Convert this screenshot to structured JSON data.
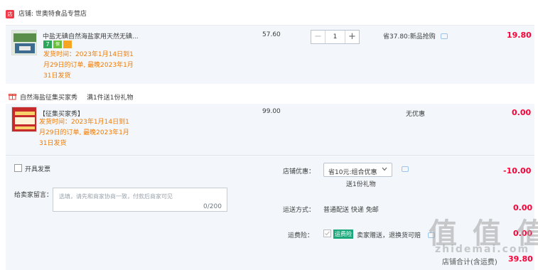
{
  "shop": {
    "label": "店铺: 世奥特食品专营店",
    "tag_icon": "shop-tag-icon"
  },
  "item1": {
    "title": "中盐无碘自然海盐家用天然无碘...",
    "badges": [
      "7",
      "保障",
      "card"
    ],
    "ship_lines": [
      "发货时间：2023年1月14日到1",
      "月29日的订单, 最晚2023年1月",
      "31日发货"
    ],
    "unit_price": "57.60",
    "quantity": "1",
    "promo": "省37.80:新品抢购",
    "subtotal": "19.80"
  },
  "gift": {
    "label": "自然海盐征集买家秀",
    "rule": "满1件送1份礼物"
  },
  "item2": {
    "title": "【征集买家秀】",
    "ship_lines": [
      "发货时间：2023年1月14日到1",
      "月29日的订单, 最晚2023年1月",
      "31日发货"
    ],
    "unit_price": "99.00",
    "promo": "无优惠",
    "subtotal": "0.00"
  },
  "invoice": {
    "label": "开具发票"
  },
  "message": {
    "label": "给卖家留言：",
    "placeholder": "选填，请先和商家协商一致，付款后商家可见",
    "counter": "0/200"
  },
  "shop_discount": {
    "label": "店铺优惠：",
    "selected": "省10元:组合优惠",
    "note": "送1份礼物",
    "amount": "-10.00"
  },
  "delivery": {
    "label": "运送方式：",
    "value": "普通配送 快递 免邮",
    "amount": "0.00"
  },
  "insurance": {
    "label": "运费险：",
    "tag": "运费险",
    "value": "卖家赠送，退换货可赔",
    "amount": "0.00"
  },
  "total": {
    "label": "店铺合计(含运费)",
    "amount": "39.80"
  },
  "watermark": {
    "text": "值 值 值",
    "sub": "zhidemai.com"
  },
  "colors": {
    "accent_red": "#ff0036",
    "ship_orange": "#f27a00",
    "panel_bg": "#f3f7fb",
    "insurance_green": "#1aa97b"
  }
}
